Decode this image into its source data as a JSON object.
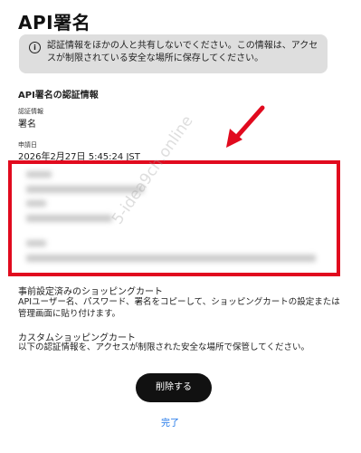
{
  "page": {
    "title": "API署名"
  },
  "notice": {
    "icon": "info-icon",
    "text": "認証情報をほかの人と共有しないでください。この情報は、アクセスが制限されている安全な場所に保存してください。"
  },
  "credentials": {
    "heading": "API署名の認証情報",
    "type_label": "認証情報",
    "type_value": "署名",
    "date_label": "申請日",
    "date_value": "2026年2月27日 5:45:24 JST"
  },
  "watermark": "5-idea9ch.online",
  "preset_cart": {
    "title": "事前設定済みのショッピングカート",
    "text": "APIユーザー名、パスワード、署名をコピーして、ショッピングカートの設定または管理画面に貼り付けます。"
  },
  "custom_cart": {
    "title": "カスタムショッピングカート",
    "text": "以下の認証情報を、アクセスが制限された安全な場所で保管してください。"
  },
  "buttons": {
    "delete": "削除する",
    "done": "完了"
  },
  "colors": {
    "annotation_red": "#e10a1e",
    "primary_button": "#111111",
    "link": "#1a73e8",
    "notice_bg": "#dedede"
  }
}
